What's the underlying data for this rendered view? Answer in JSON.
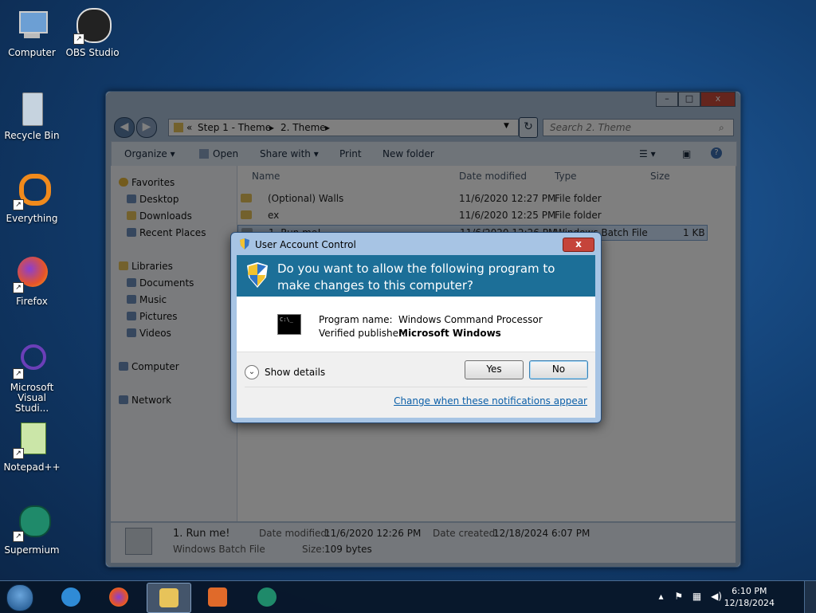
{
  "desktop": {
    "icons": [
      {
        "label": "Computer"
      },
      {
        "label": "OBS Studio"
      },
      {
        "label": "Recycle Bin"
      },
      {
        "label": "Everything"
      },
      {
        "label": "Firefox"
      },
      {
        "label": "Microsoft Visual Studi..."
      },
      {
        "label": "Notepad++"
      },
      {
        "label": "Supermium"
      }
    ]
  },
  "explorer": {
    "address": {
      "prefix": "«",
      "crumb1": "Step 1 - Theme",
      "crumb2": "2. Theme"
    },
    "search_placeholder": "Search 2. Theme",
    "toolbar": {
      "organize": "Organize ▾",
      "open": "Open",
      "share_with": "Share with ▾",
      "print": "Print",
      "new_folder": "New folder"
    },
    "nav": {
      "favorites": "Favorites",
      "desktop": "Desktop",
      "downloads": "Downloads",
      "recent_places": "Recent Places",
      "libraries": "Libraries",
      "documents": "Documents",
      "music": "Music",
      "pictures": "Pictures",
      "videos": "Videos",
      "computer": "Computer",
      "network": "Network"
    },
    "columns": {
      "name": "Name",
      "date_modified": "Date modified",
      "type": "Type",
      "size": "Size"
    },
    "files": [
      {
        "name": "(Optional) Walls",
        "date": "11/6/2020 12:27 PM",
        "type": "File folder",
        "size": ""
      },
      {
        "name": "ex",
        "date": "11/6/2020 12:25 PM",
        "type": "File folder",
        "size": ""
      },
      {
        "name": "1. Run me!",
        "date": "11/6/2020 12:26 PM",
        "type": "Windows Batch File",
        "size": "1 KB"
      }
    ],
    "details": {
      "filename": "1. Run me!",
      "filetype": "Windows Batch File",
      "modified_label": "Date modified:",
      "modified_value": "11/6/2020 12:26 PM",
      "created_label": "Date created:",
      "created_value": "12/18/2024 6:07 PM",
      "size_label": "Size:",
      "size_value": "109 bytes"
    }
  },
  "uac": {
    "title": "User Account Control",
    "close": "x",
    "question": "Do you want to allow the following program to make changes to this computer?",
    "program_label": "Program name:",
    "program_value": "Windows Command Processor",
    "publisher_label": "Verified publisher:",
    "publisher_value": "Microsoft Windows",
    "cmd_glyph": "C:\\_",
    "show_details": "Show details",
    "yes": "Yes",
    "no": "No",
    "link": "Change when these notifications appear"
  },
  "taskbar": {
    "time": "6:10 PM",
    "date": "12/18/2024"
  }
}
